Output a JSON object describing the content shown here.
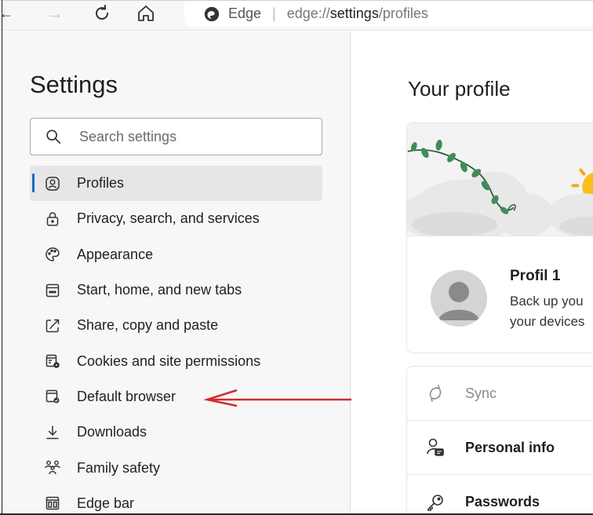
{
  "browser": {
    "back_glyph": "←",
    "forward_glyph": "→",
    "refresh_glyph": "↻",
    "home_glyph": "⌂",
    "address_label": "Edge",
    "address_separator": "|",
    "url_prefix": "edge://",
    "url_host": "settings",
    "url_path": "/profiles"
  },
  "sidebar": {
    "title": "Settings",
    "search_placeholder": "Search settings",
    "items": [
      {
        "label": "Profiles",
        "icon": "profile-icon",
        "active": true
      },
      {
        "label": "Privacy, search, and services",
        "icon": "lock-icon"
      },
      {
        "label": "Appearance",
        "icon": "palette-icon"
      },
      {
        "label": "Start, home, and new tabs",
        "icon": "start-page-icon"
      },
      {
        "label": "Share, copy and paste",
        "icon": "share-icon"
      },
      {
        "label": "Cookies and site permissions",
        "icon": "cookies-settings-icon"
      },
      {
        "label": "Default browser",
        "icon": "default-browser-icon"
      },
      {
        "label": "Downloads",
        "icon": "download-icon"
      },
      {
        "label": "Family safety",
        "icon": "family-icon"
      },
      {
        "label": "Edge bar",
        "icon": "edge-bar-icon"
      }
    ]
  },
  "main": {
    "heading": "Your profile",
    "profile": {
      "name": "Profil 1",
      "desc_line1": "Back up you",
      "desc_line2": "your devices"
    },
    "rows": [
      {
        "label": "Sync",
        "icon": "sync-icon",
        "disabled": true
      },
      {
        "label": "Personal info",
        "icon": "personal-info-icon"
      },
      {
        "label": "Passwords",
        "icon": "key-icon"
      }
    ]
  },
  "colors": {
    "accent": "#0f6cbd",
    "annotation_arrow": "#d42a2a",
    "sidebar_bg": "#f7f7f7",
    "active_item_bg": "#e6e6e6"
  }
}
